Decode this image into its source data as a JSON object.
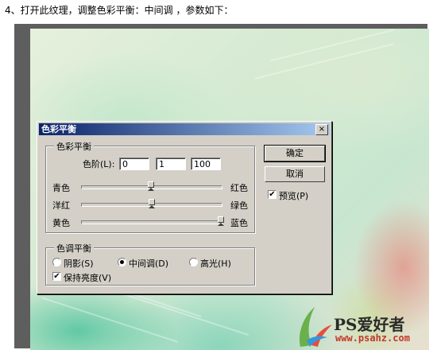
{
  "caption": "4、打开此纹理，调整色彩平衡：中间调 ，参数如下：",
  "dialog": {
    "title": "色彩平衡",
    "close_glyph": "×",
    "color_balance_group": {
      "legend": "色彩平衡",
      "levels_label": "色阶(L):",
      "levels_values": [
        "0",
        "1",
        "100"
      ],
      "sliders": [
        {
          "left": "青色",
          "right": "红色",
          "value": 0,
          "min": -100,
          "max": 100
        },
        {
          "left": "洋红",
          "right": "绿色",
          "value": 1,
          "min": -100,
          "max": 100
        },
        {
          "left": "黄色",
          "right": "蓝色",
          "value": 100,
          "min": -100,
          "max": 100
        }
      ]
    },
    "tone_balance_group": {
      "legend": "色调平衡",
      "options": [
        {
          "label": "阴影(S)",
          "selected": false
        },
        {
          "label": "中间调(D)",
          "selected": true
        },
        {
          "label": "高光(H)",
          "selected": false
        }
      ],
      "preserve_luminosity": {
        "label": "保持亮度(V)",
        "checked": true
      }
    },
    "buttons": {
      "ok": "确定",
      "cancel": "取消"
    },
    "preview": {
      "label": "预览(P)",
      "checked": true
    }
  },
  "watermark": {
    "text": "PS爱好者",
    "url": "www.psahz.com"
  },
  "colors": {
    "title_start": "#0a246a",
    "title_end": "#a6caf0",
    "dialog_bg": "#d4d0c8"
  }
}
